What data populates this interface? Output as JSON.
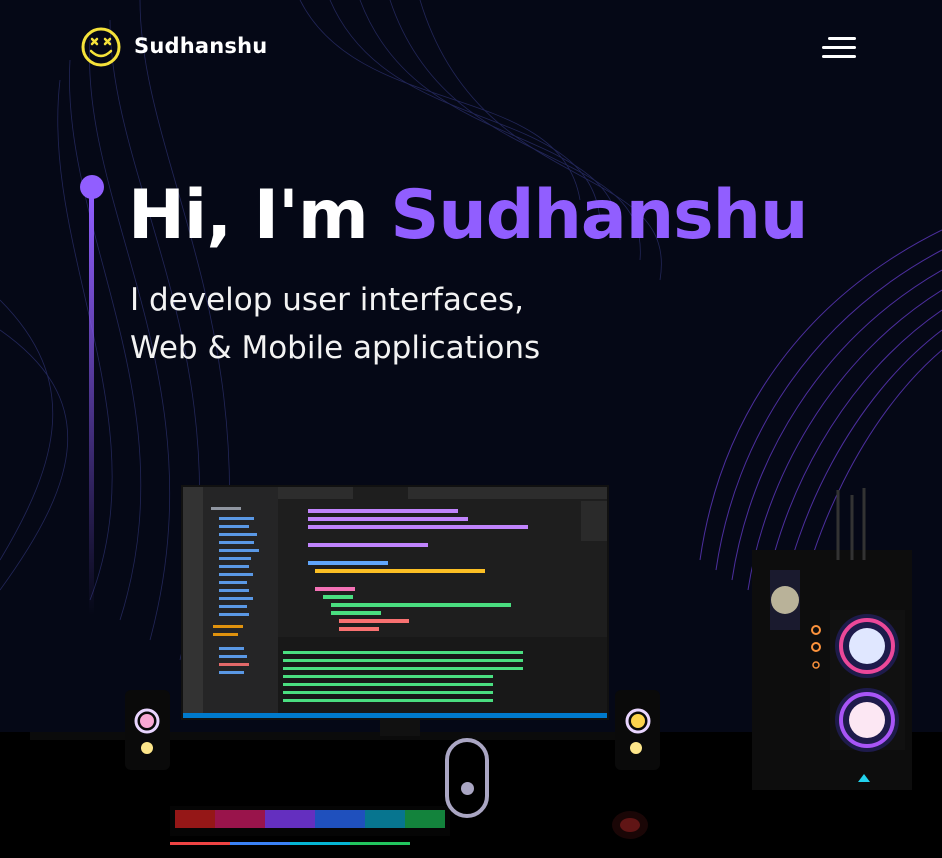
{
  "nav": {
    "brand": "Sudhanshu",
    "logo_icon": "smiley-x-eyes-icon",
    "menu_icon": "hamburger-menu-icon"
  },
  "hero": {
    "greeting": "Hi, I'm",
    "name": "Sudhanshu",
    "subtitle_line1": "I develop user interfaces,",
    "subtitle_line2": "Web & Mobile applications"
  },
  "scene": {
    "description_icon": "desk-setup-3d-model",
    "scroll_icon": "mouse-scroll-indicator-icon"
  },
  "colors": {
    "background": "#050816",
    "accent": "#915eff",
    "text": "#ffffff",
    "logo": "#f5e23a"
  }
}
